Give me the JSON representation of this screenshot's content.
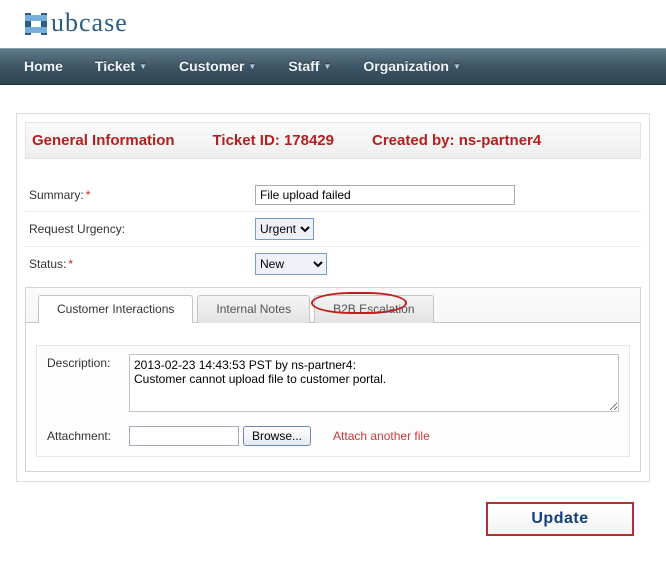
{
  "logo": {
    "text": "ubcase"
  },
  "nav": {
    "home": "Home",
    "ticket": "Ticket",
    "customer": "Customer",
    "staff": "Staff",
    "organization": "Organization"
  },
  "titlebar": {
    "section": "General Information",
    "ticket_label": "Ticket ID: 178429",
    "created_label": "Created by: ns-partner4"
  },
  "fields": {
    "summary_label": "Summary:",
    "summary_value": "File upload failed",
    "urgency_label": "Request Urgency:",
    "urgency_value": "Urgent",
    "status_label": "Status:",
    "status_value": "New"
  },
  "tabs": {
    "customer": "Customer Interactions",
    "internal": "Internal Notes",
    "b2b": "B2B Escalation"
  },
  "panel": {
    "desc_label": "Description:",
    "desc_value": "2013-02-23 14:43:53 PST by ns-partner4:\nCustomer cannot upload file to customer portal.",
    "att_label": "Attachment:",
    "browse_label": "Browse...",
    "attach_another": "Attach another file"
  },
  "actions": {
    "update": "Update"
  }
}
